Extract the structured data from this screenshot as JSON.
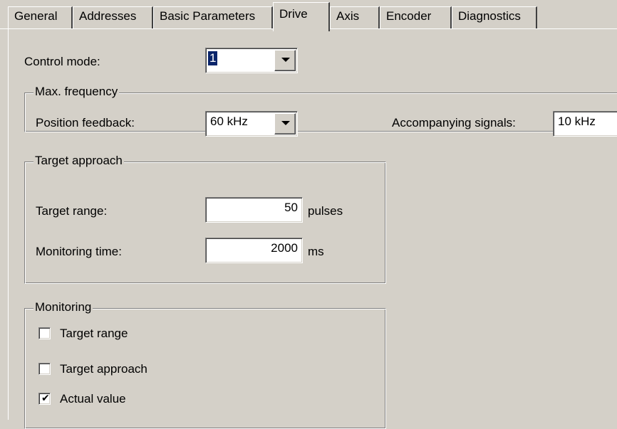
{
  "tabs": [
    {
      "label": "General"
    },
    {
      "label": "Addresses"
    },
    {
      "label": "Basic Parameters"
    },
    {
      "label": "Drive",
      "active": true
    },
    {
      "label": "Axis"
    },
    {
      "label": "Encoder"
    },
    {
      "label": "Diagnostics"
    }
  ],
  "control_mode": {
    "label": "Control mode:",
    "value": "1"
  },
  "max_frequency": {
    "title": "Max. frequency",
    "position_feedback": {
      "label": "Position feedback:",
      "value": "60 kHz"
    },
    "accompanying_signals": {
      "label": "Accompanying signals:",
      "value": "10 kHz"
    }
  },
  "target_approach": {
    "title": "Target approach",
    "target_range": {
      "label": "Target range:",
      "value": "50",
      "unit": "pulses"
    },
    "monitoring_time": {
      "label": "Monitoring time:",
      "value": "2000",
      "unit": "ms"
    }
  },
  "monitoring": {
    "title": "Monitoring",
    "items": [
      {
        "label": "Target range",
        "checked": false
      },
      {
        "label": "Target approach",
        "checked": false
      },
      {
        "label": "Actual value",
        "checked": true
      }
    ]
  },
  "icons": {
    "dropdown": "chevron-down-icon",
    "check": "check-icon"
  },
  "colors": {
    "face": "#d4d0c8",
    "selection": "#0a246a",
    "field": "#ffffff"
  }
}
